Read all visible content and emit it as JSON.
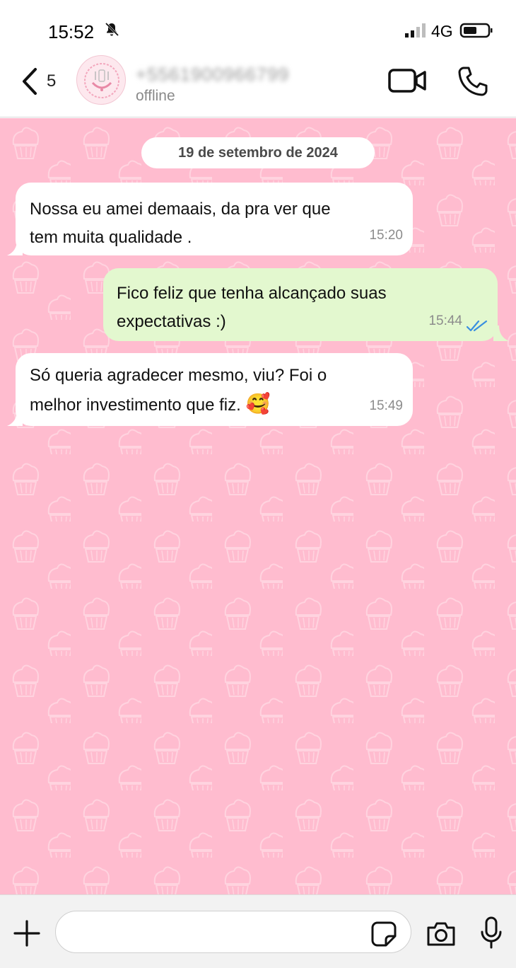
{
  "status_bar": {
    "time": "15:52",
    "network": "4G",
    "icons": [
      "bell-off-icon",
      "signal-icon",
      "battery-icon"
    ]
  },
  "header": {
    "back_count": "5",
    "contact_name": "+5561900966799",
    "contact_status": "offline",
    "icons": [
      "back-icon",
      "avatar",
      "video-call-icon",
      "phone-icon"
    ]
  },
  "chat": {
    "background_color": "#ffbccf",
    "date_separator": "19 de setembro de 2024",
    "messages": [
      {
        "direction": "incoming",
        "text": "Nossa eu amei demaais, da pra ver que\ntem muita qualidade .",
        "time": "15:20"
      },
      {
        "direction": "outgoing",
        "text": "Fico feliz que tenha alcançado suas\nexpectativas :)",
        "time": "15:44",
        "status": "read",
        "status_icon": "double-check-icon"
      },
      {
        "direction": "incoming",
        "text": "Só queria agradecer mesmo, viu? Foi o\nmelhor investimento que fiz.",
        "emoji": "🥰",
        "time": "15:49"
      }
    ]
  },
  "input_bar": {
    "placeholder": "",
    "icons": [
      "plus-icon",
      "sticker-icon",
      "camera-icon",
      "mic-icon"
    ]
  },
  "colors": {
    "incoming_bubble": "#ffffff",
    "outgoing_bubble": "#e3f8cf",
    "read_check": "#3a8fe0",
    "chat_background": "#ffbccf"
  }
}
